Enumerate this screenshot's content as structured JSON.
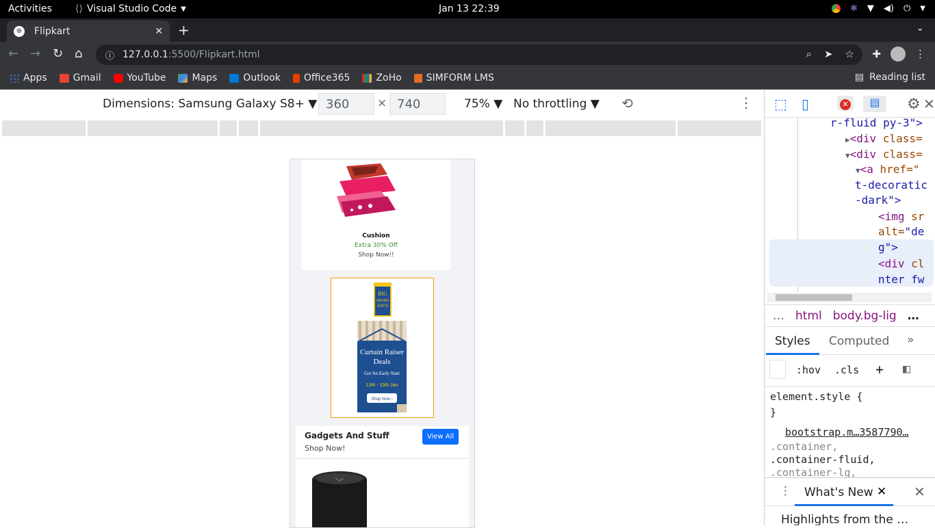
{
  "system": {
    "activities": "Activities",
    "app_name": "Visual Studio Code",
    "clock": "Jan 13  22:39"
  },
  "browser": {
    "tab_title": "Flipkart",
    "url_host": "127.0.0.1",
    "url_path": ":5500/Flipkart.html",
    "bookmarks": [
      {
        "label": "Apps",
        "color": "#4285f4"
      },
      {
        "label": "Gmail",
        "color": "#ea4335"
      },
      {
        "label": "YouTube",
        "color": "#ff0000"
      },
      {
        "label": "Maps",
        "color": "#34a853"
      },
      {
        "label": "Outlook",
        "color": "#0078d4"
      },
      {
        "label": "Office365",
        "color": "#eb3c00"
      },
      {
        "label": "ZoHo",
        "color": "#f5b400"
      },
      {
        "label": "SIMFORM LMS",
        "color": "#e86a25"
      }
    ],
    "reading_list": "Reading list"
  },
  "device_toolbar": {
    "dimensions": "Dimensions: Samsung Galaxy S8+ ▼",
    "width": "360",
    "times": "×",
    "height": "740",
    "zoom": "75% ▼",
    "throttle": "No throttling ▼"
  },
  "page": {
    "cushion_title": "Cushion",
    "cushion_offer": "Extra 30% Off",
    "cushion_cta": "Shop Now!!",
    "banner": {
      "line1": "BIG",
      "line2": "SAVING",
      "line3": "DAYS",
      "title1": "Curtain Raiser",
      "title2": "Deals",
      "subtitle": "Get An Early Start",
      "dates": "13th - 15th Jan",
      "cta": "Shop Now ›"
    },
    "gadgets_title": "Gadgets And Stuff",
    "gadgets_sub": "Shop Now!",
    "view_all": "View All"
  },
  "devtools": {
    "elements": {
      "l1": "r-fluid py-3\">",
      "l2_tag": "<div",
      "l2_attr": "class=",
      "l3_tag": "<div",
      "l3_attr": "class=",
      "l4_tag": "<a",
      "l4_attr": "href=\"",
      "l5": "t-decoratic",
      "l6": "-dark\">",
      "l7_tag": "<img",
      "l7_attr": "sr",
      "l8_attr": "alt=",
      "l8_val": "\"de",
      "l9": "g\">",
      "l10_tag": "<div",
      "l10_attr": "cl",
      "l11": "nter fw"
    },
    "crumbs": {
      "ellipsis": "…",
      "html": "html",
      "body": "body.bg-lig",
      "more": "…"
    },
    "tabs": {
      "styles": "Styles",
      "computed": "Computed",
      "more": "»"
    },
    "filter": {
      "hov": ":hov",
      "cls": ".cls",
      "plus": "+"
    },
    "rules": {
      "element_style": "element.style {",
      "close": "}",
      "source": "bootstrap.m…3587790…",
      "sel1": ".container,",
      "sel2": ".container-fluid,",
      "sel3": ".container-lg,"
    },
    "drawer": {
      "whats_new": "What's New",
      "highlights": "Highlights from the …"
    }
  }
}
